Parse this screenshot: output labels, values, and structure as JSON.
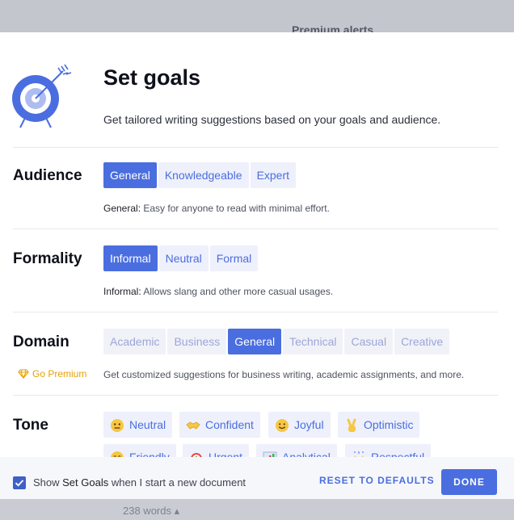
{
  "backdrop": {
    "premium_alerts": "Premium alerts",
    "word_count": "238 words ▴"
  },
  "header": {
    "title": "Set goals",
    "subtitle": "Get tailored writing suggestions based on your goals and audience."
  },
  "audience": {
    "label": "Audience",
    "options": [
      "General",
      "Knowledgeable",
      "Expert"
    ],
    "selected": "General",
    "desc_term": "General:",
    "desc_text": " Easy for anyone to read with minimal effort."
  },
  "formality": {
    "label": "Formality",
    "options": [
      "Informal",
      "Neutral",
      "Formal"
    ],
    "selected": "Informal",
    "desc_term": "Informal:",
    "desc_text": " Allows slang and other more casual usages."
  },
  "domain": {
    "label": "Domain",
    "options": [
      "Academic",
      "Business",
      "General",
      "Technical",
      "Casual",
      "Creative"
    ],
    "selected": "General",
    "premium_link": "Go Premium",
    "desc_text": "Get customized suggestions for business writing, academic assignments, and more."
  },
  "tone": {
    "label": "Tone",
    "options": [
      {
        "label": "Neutral",
        "icon": "neutral-face-icon"
      },
      {
        "label": "Confident",
        "icon": "handshake-icon"
      },
      {
        "label": "Joyful",
        "icon": "smile-face-icon"
      },
      {
        "label": "Optimistic",
        "icon": "victory-hand-icon"
      },
      {
        "label": "Friendly",
        "icon": "friendly-face-icon"
      },
      {
        "label": "Urgent",
        "icon": "alarm-clock-icon"
      },
      {
        "label": "Analytical",
        "icon": "bar-chart-icon"
      },
      {
        "label": "Respectful",
        "icon": "raised-hands-icon"
      }
    ]
  },
  "footer": {
    "show_prefix": "Show ",
    "show_term": "Set Goals",
    "show_suffix": " when I start a new document",
    "checked": true,
    "reset_label": "RESET TO DEFAULTS",
    "done_label": "DONE"
  },
  "colors": {
    "accent": "#4a6ee0",
    "premium": "#e6a100"
  }
}
